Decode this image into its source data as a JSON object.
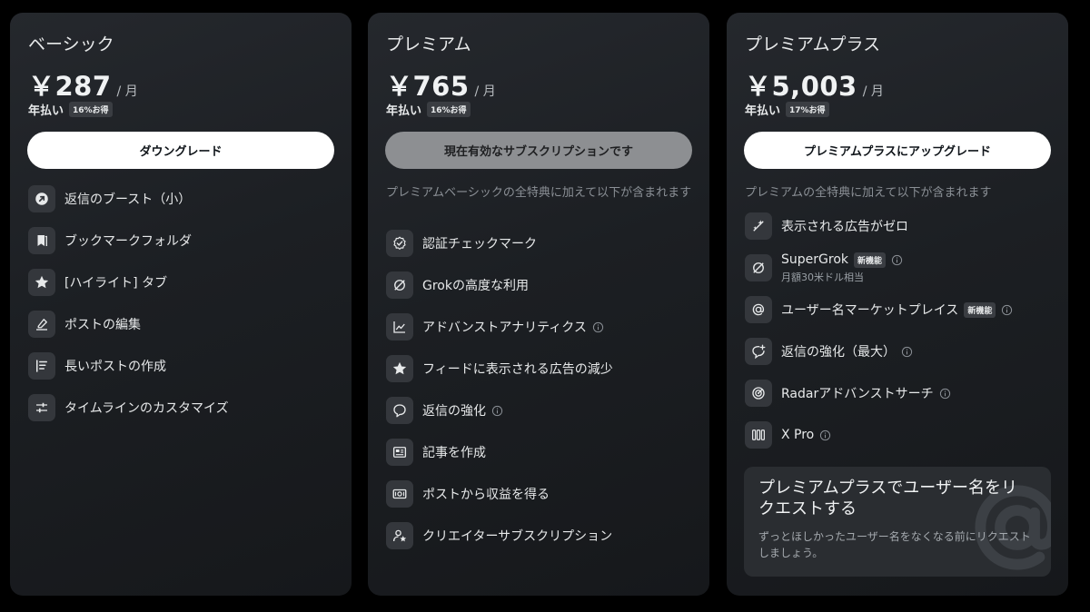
{
  "plans": [
    {
      "name": "ベーシック",
      "price": "￥287",
      "period": "/ 月",
      "billing": "年払い",
      "discount": "16%お得",
      "cta": "ダウングレード",
      "features": [
        {
          "icon": "boost-arrow-icon",
          "label": "返信のブースト（小）"
        },
        {
          "icon": "bookmark-folder-icon",
          "label": "ブックマークフォルダ"
        },
        {
          "icon": "star-icon",
          "label": "[ハイライト] タブ"
        },
        {
          "icon": "edit-post-icon",
          "label": "ポストの編集"
        },
        {
          "icon": "long-post-icon",
          "label": "長いポストの作成"
        },
        {
          "icon": "customize-sliders-icon",
          "label": "タイムラインのカスタマイズ"
        }
      ]
    },
    {
      "name": "プレミアム",
      "price": "￥765",
      "period": "/ 月",
      "billing": "年払い",
      "discount": "16%お得",
      "cta": "現在有効なサブスクリプションです",
      "intro": "プレミアムベーシックの全特典に加えて以下が含まれます",
      "features": [
        {
          "icon": "verified-check-icon",
          "label": "認証チェックマーク"
        },
        {
          "icon": "grok-icon",
          "label": "Grokの高度な利用"
        },
        {
          "icon": "analytics-chart-icon",
          "label": "アドバンストアナリティクス"
        },
        {
          "icon": "star-icon",
          "label": "フィードに表示される広告の減少"
        },
        {
          "icon": "speech-bubble-icon",
          "label": "返信の強化"
        },
        {
          "icon": "article-icon",
          "label": "記事を作成"
        },
        {
          "icon": "money-icon",
          "label": "ポストから収益を得る"
        },
        {
          "icon": "creator-star-icon",
          "label": "クリエイターサブスクリプション"
        }
      ]
    },
    {
      "name": "プレミアムプラス",
      "price": "￥5,003",
      "period": "/ 月",
      "billing": "年払い",
      "discount": "17%お得",
      "cta": "プレミアムプラスにアップグレード",
      "intro": "プレミアムの全特典に加えて以下が含まれます",
      "features": [
        {
          "icon": "no-ads-icon",
          "label": "表示される広告がゼロ"
        },
        {
          "icon": "grok-icon",
          "label": "SuperGrok",
          "badge": "新機能",
          "sub": "月額30米ドル相当"
        },
        {
          "icon": "at-sign-icon",
          "label": "ユーザー名マーケットプレイス",
          "badge": "新機能"
        },
        {
          "icon": "reply-boost-icon",
          "label": "返信の強化（最大）"
        },
        {
          "icon": "radar-icon",
          "label": "Radarアドバンストサーチ"
        },
        {
          "icon": "xpro-columns-icon",
          "label": "X Pro"
        }
      ],
      "promo": {
        "title": "プレミアムプラスでユーザー名をリクエストする",
        "body": "ずっとほしかったユーザー名をなくなる前にリクエストしましょう。"
      }
    }
  ]
}
